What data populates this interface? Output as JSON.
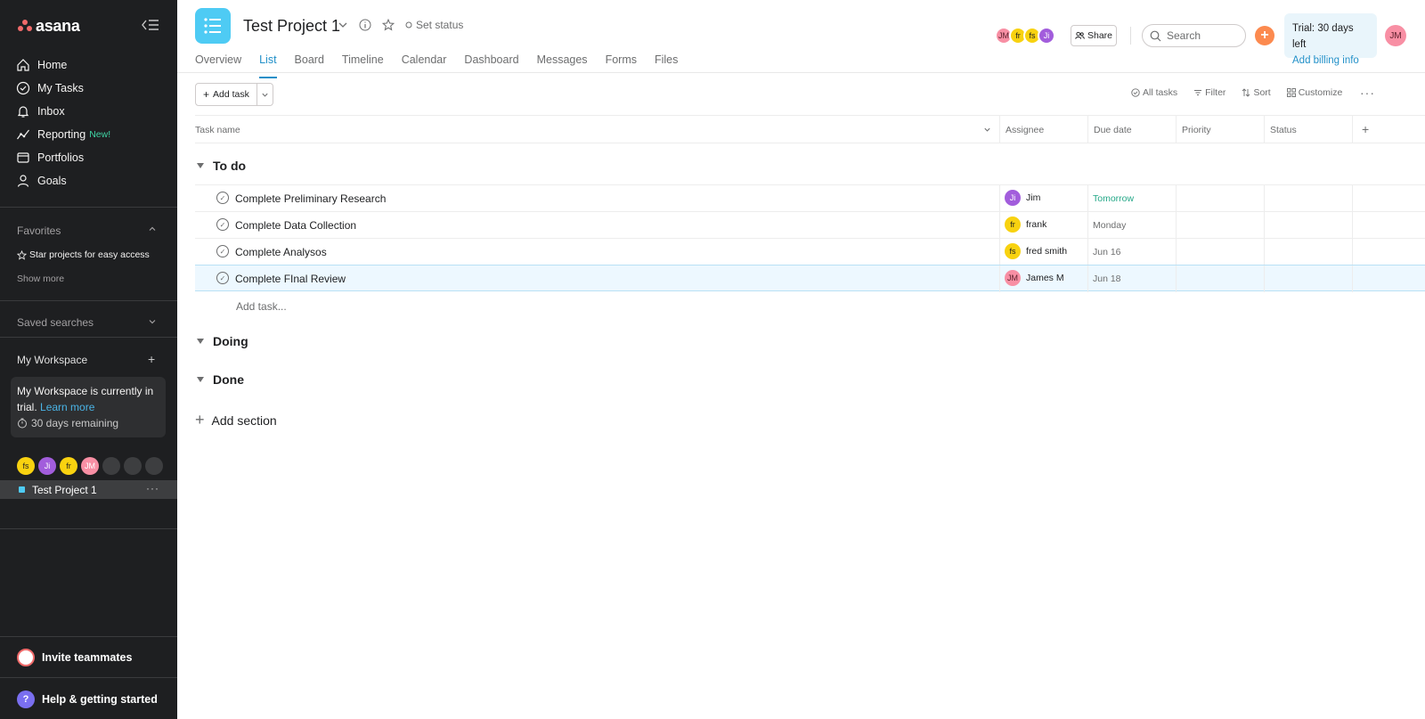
{
  "sidebar": {
    "logo_text": "asana",
    "nav": [
      {
        "label": "Home",
        "icon": "home-icon"
      },
      {
        "label": "My Tasks",
        "icon": "check-circle-icon"
      },
      {
        "label": "Inbox",
        "icon": "bell-icon"
      },
      {
        "label": "Reporting",
        "icon": "trend-line-icon",
        "badge": "New!"
      },
      {
        "label": "Portfolios",
        "icon": "folder-icon"
      },
      {
        "label": "Goals",
        "icon": "person-icon"
      }
    ],
    "favorites_label": "Favorites",
    "favorites_hint": "Star projects for easy access",
    "show_more": "Show more",
    "saved_searches": "Saved searches",
    "workspace_label": "My Workspace",
    "trial_card": {
      "text": "My Workspace is currently in trial.",
      "link": "Learn more",
      "remaining": "30 days remaining"
    },
    "members": [
      {
        "initials": "fs",
        "color": "#f8d210"
      },
      {
        "initials": "Ji",
        "color": "#a25ddc"
      },
      {
        "initials": "fr",
        "color": "#f8d210"
      },
      {
        "initials": "JM",
        "color": "#f88fa4"
      },
      {
        "initials": "",
        "color": "#3d3e40"
      },
      {
        "initials": "",
        "color": "#3d3e40"
      },
      {
        "initials": "",
        "color": "#3d3e40"
      }
    ],
    "project": "Test Project 1",
    "project_more": "···",
    "invite": "Invite teammates",
    "help": "Help & getting started",
    "help_glyph": "?"
  },
  "header": {
    "title": "Test Project 1",
    "set_status": "Set status",
    "tabs": [
      "Overview",
      "List",
      "Board",
      "Timeline",
      "Calendar",
      "Dashboard",
      "Messages",
      "Forms",
      "Files"
    ],
    "active_tab": "List",
    "members": [
      {
        "initials": "JM",
        "color": "#f88fa4"
      },
      {
        "initials": "fr",
        "color": "#f8d210"
      },
      {
        "initials": "fs",
        "color": "#f8d210"
      },
      {
        "initials": "Ji",
        "color": "#a25ddc"
      }
    ],
    "share": "Share",
    "search_placeholder": "Search",
    "trial_line": "Trial: 30 days left",
    "billing_link": "Add billing info",
    "me_initials": "JM"
  },
  "toolbar": {
    "add_task": "Add task",
    "all_tasks": "All tasks",
    "filter": "Filter",
    "sort": "Sort",
    "customize": "Customize",
    "more": "···"
  },
  "columns": {
    "task_name": "Task name",
    "assignee": "Assignee",
    "due_date": "Due date",
    "priority": "Priority",
    "status": "Status"
  },
  "sections": [
    {
      "name": "To do",
      "tasks": [
        {
          "name": "Complete Preliminary Research",
          "assignee": "Jim",
          "initials": "Ji",
          "color": "#a25ddc",
          "due": "Tomorrow"
        },
        {
          "name": "Complete Data Collection",
          "assignee": "frank",
          "initials": "fr",
          "color": "#f8d210",
          "due": "Monday"
        },
        {
          "name": "Complete Analysos",
          "assignee": "fred smith",
          "initials": "fs",
          "color": "#f8d210",
          "due": "Jun 16"
        },
        {
          "name": "Complete FInal Review",
          "assignee": "James M",
          "initials": "JM",
          "color": "#f88fa4",
          "due": "Jun 18"
        }
      ],
      "add_task": "Add task..."
    },
    {
      "name": "Doing"
    },
    {
      "name": "Done"
    }
  ],
  "add_section": "Add section",
  "colors": {
    "accent": "#1f8fc8",
    "sidebar_bg": "#1e1f21",
    "project_icon": "#4ecbf4",
    "due_soon": "#25a888"
  }
}
